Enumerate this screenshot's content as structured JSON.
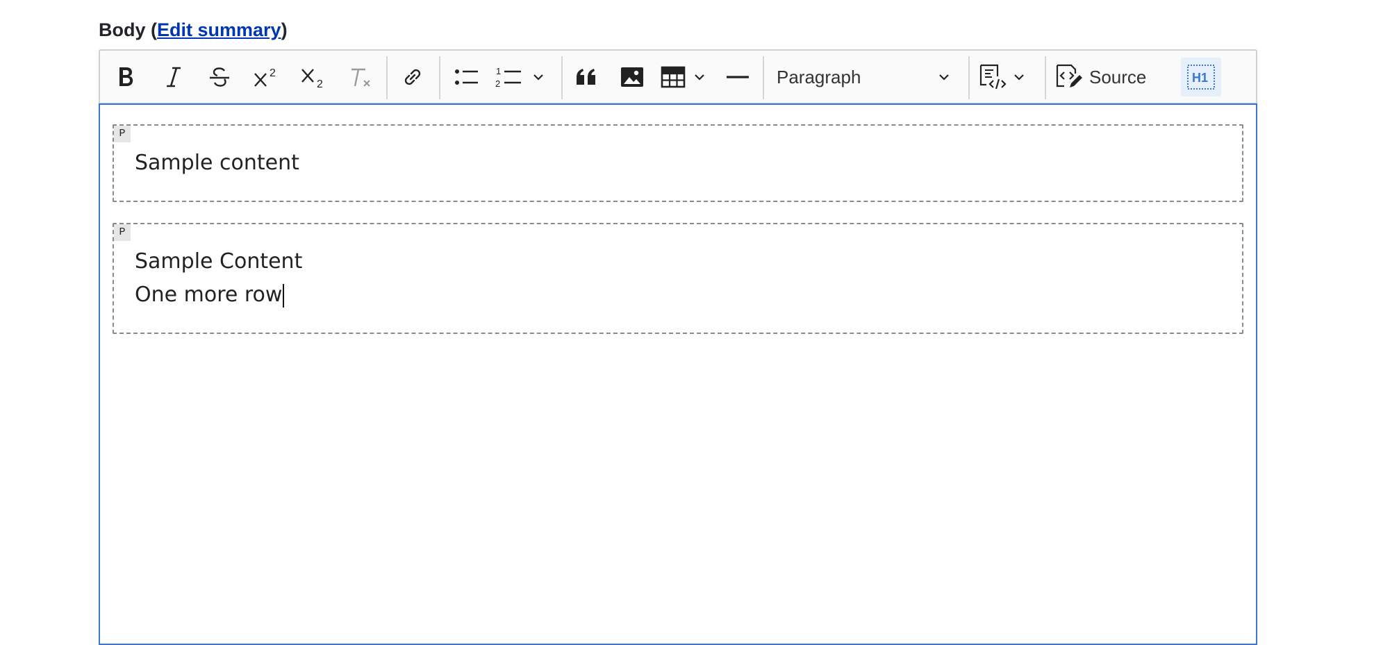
{
  "field": {
    "label": "Body",
    "open_paren": " (",
    "edit_summary_link": "Edit summary",
    "close_paren": ")"
  },
  "toolbar": {
    "buttons": [
      {
        "name": "bold",
        "icon": "bold-icon"
      },
      {
        "name": "italic",
        "icon": "italic-icon"
      },
      {
        "name": "strikethrough",
        "icon": "strikethrough-icon"
      },
      {
        "name": "superscript",
        "icon": "superscript-icon"
      },
      {
        "name": "subscript",
        "icon": "subscript-icon"
      },
      {
        "name": "remove-format",
        "icon": "remove-format-icon",
        "disabled": true
      },
      {
        "name": "link",
        "icon": "link-icon"
      },
      {
        "name": "bulleted-list",
        "icon": "bulleted-list-icon"
      },
      {
        "name": "numbered-list",
        "icon": "numbered-list-icon"
      },
      {
        "name": "block-quote",
        "icon": "quote-icon"
      },
      {
        "name": "insert-image",
        "icon": "image-icon"
      },
      {
        "name": "insert-table",
        "icon": "table-icon"
      },
      {
        "name": "horizontal-line",
        "icon": "horizontal-line-icon"
      },
      {
        "name": "code-block",
        "icon": "code-block-icon"
      },
      {
        "name": "show-blocks",
        "icon": "show-blocks-icon",
        "active": true
      }
    ],
    "heading_dropdown_value": "Paragraph",
    "source_label": "Source",
    "active_color": "#3a76d6",
    "active_bg": "#e6f0fb"
  },
  "content": {
    "blocks": [
      {
        "tag": "P",
        "lines": [
          "Sample content"
        ]
      },
      {
        "tag": "P",
        "lines": [
          "Sample Content",
          "One more row"
        ]
      }
    ]
  }
}
